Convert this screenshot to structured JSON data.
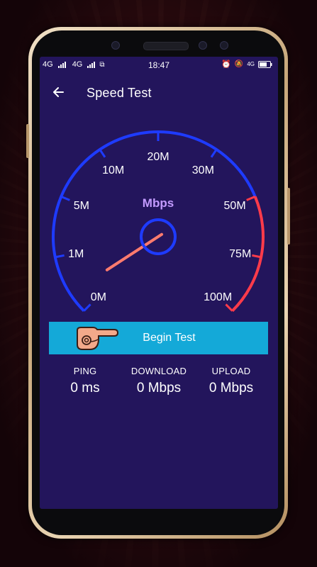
{
  "status": {
    "net1": "4G",
    "net2": "4G",
    "time": "18:47",
    "extra": "4G"
  },
  "appbar": {
    "title": "Speed Test"
  },
  "gauge": {
    "unit": "Mbps",
    "ticks": [
      "0M",
      "1M",
      "5M",
      "10M",
      "20M",
      "30M",
      "50M",
      "75M",
      "100M"
    ],
    "current_value_mbps": 0,
    "colors": {
      "normal": "#1e3bff",
      "high": "#ff3b4a",
      "needle": "#ff7b6e",
      "hub": "#1e3bff",
      "unit": "#c39bff"
    }
  },
  "begin_button": {
    "label": "Begin Test"
  },
  "stats": {
    "ping": {
      "label": "PING",
      "value": "0 ms"
    },
    "download": {
      "label": "DOWNLOAD",
      "value": "0 Mbps"
    },
    "upload": {
      "label": "UPLOAD",
      "value": "0 Mbps"
    }
  },
  "theme": {
    "screen_bg": "#23155c",
    "button_bg": "#14a9d8"
  }
}
